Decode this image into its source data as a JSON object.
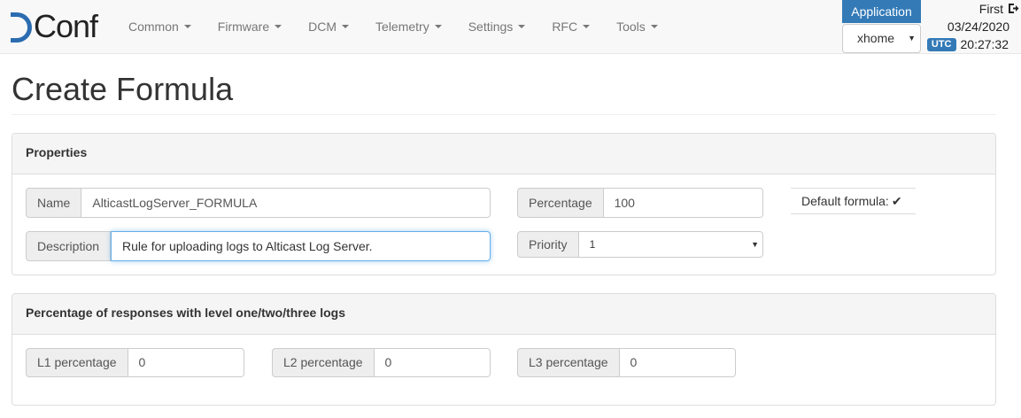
{
  "brand": {
    "logo_text": "Conf"
  },
  "nav": {
    "items": [
      {
        "label": "Common"
      },
      {
        "label": "Firmware"
      },
      {
        "label": "DCM"
      },
      {
        "label": "Telemetry"
      },
      {
        "label": "Settings"
      },
      {
        "label": "RFC"
      },
      {
        "label": "Tools"
      }
    ]
  },
  "application": {
    "label": "Application",
    "selected": "xhome"
  },
  "user": {
    "name": "First",
    "date": "03/24/2020",
    "timezone": "UTC",
    "time": "20:27:32"
  },
  "page": {
    "title": "Create Formula"
  },
  "properties": {
    "heading": "Properties",
    "name_label": "Name",
    "name_value": "AlticastLogServer_FORMULA",
    "percentage_label": "Percentage",
    "percentage_value": "100",
    "default_label": "Default formula:",
    "description_label": "Description",
    "description_value": "Rule for uploading logs to Alticast Log Server.",
    "priority_label": "Priority",
    "priority_value": "1"
  },
  "levels": {
    "heading": "Percentage of responses with level one/two/three logs",
    "l1_label": "L1 percentage",
    "l1_value": "0",
    "l2_label": "L2 percentage",
    "l2_value": "0",
    "l3_label": "L3 percentage",
    "l3_value": "0"
  },
  "colors": {
    "accent": "#337ab7",
    "focus": "#66afe9",
    "navbar_bg": "#f8f8f8"
  },
  "icons": {
    "logout": "logout-icon",
    "check": "checkmark-icon",
    "caret": "caret-down-icon"
  }
}
